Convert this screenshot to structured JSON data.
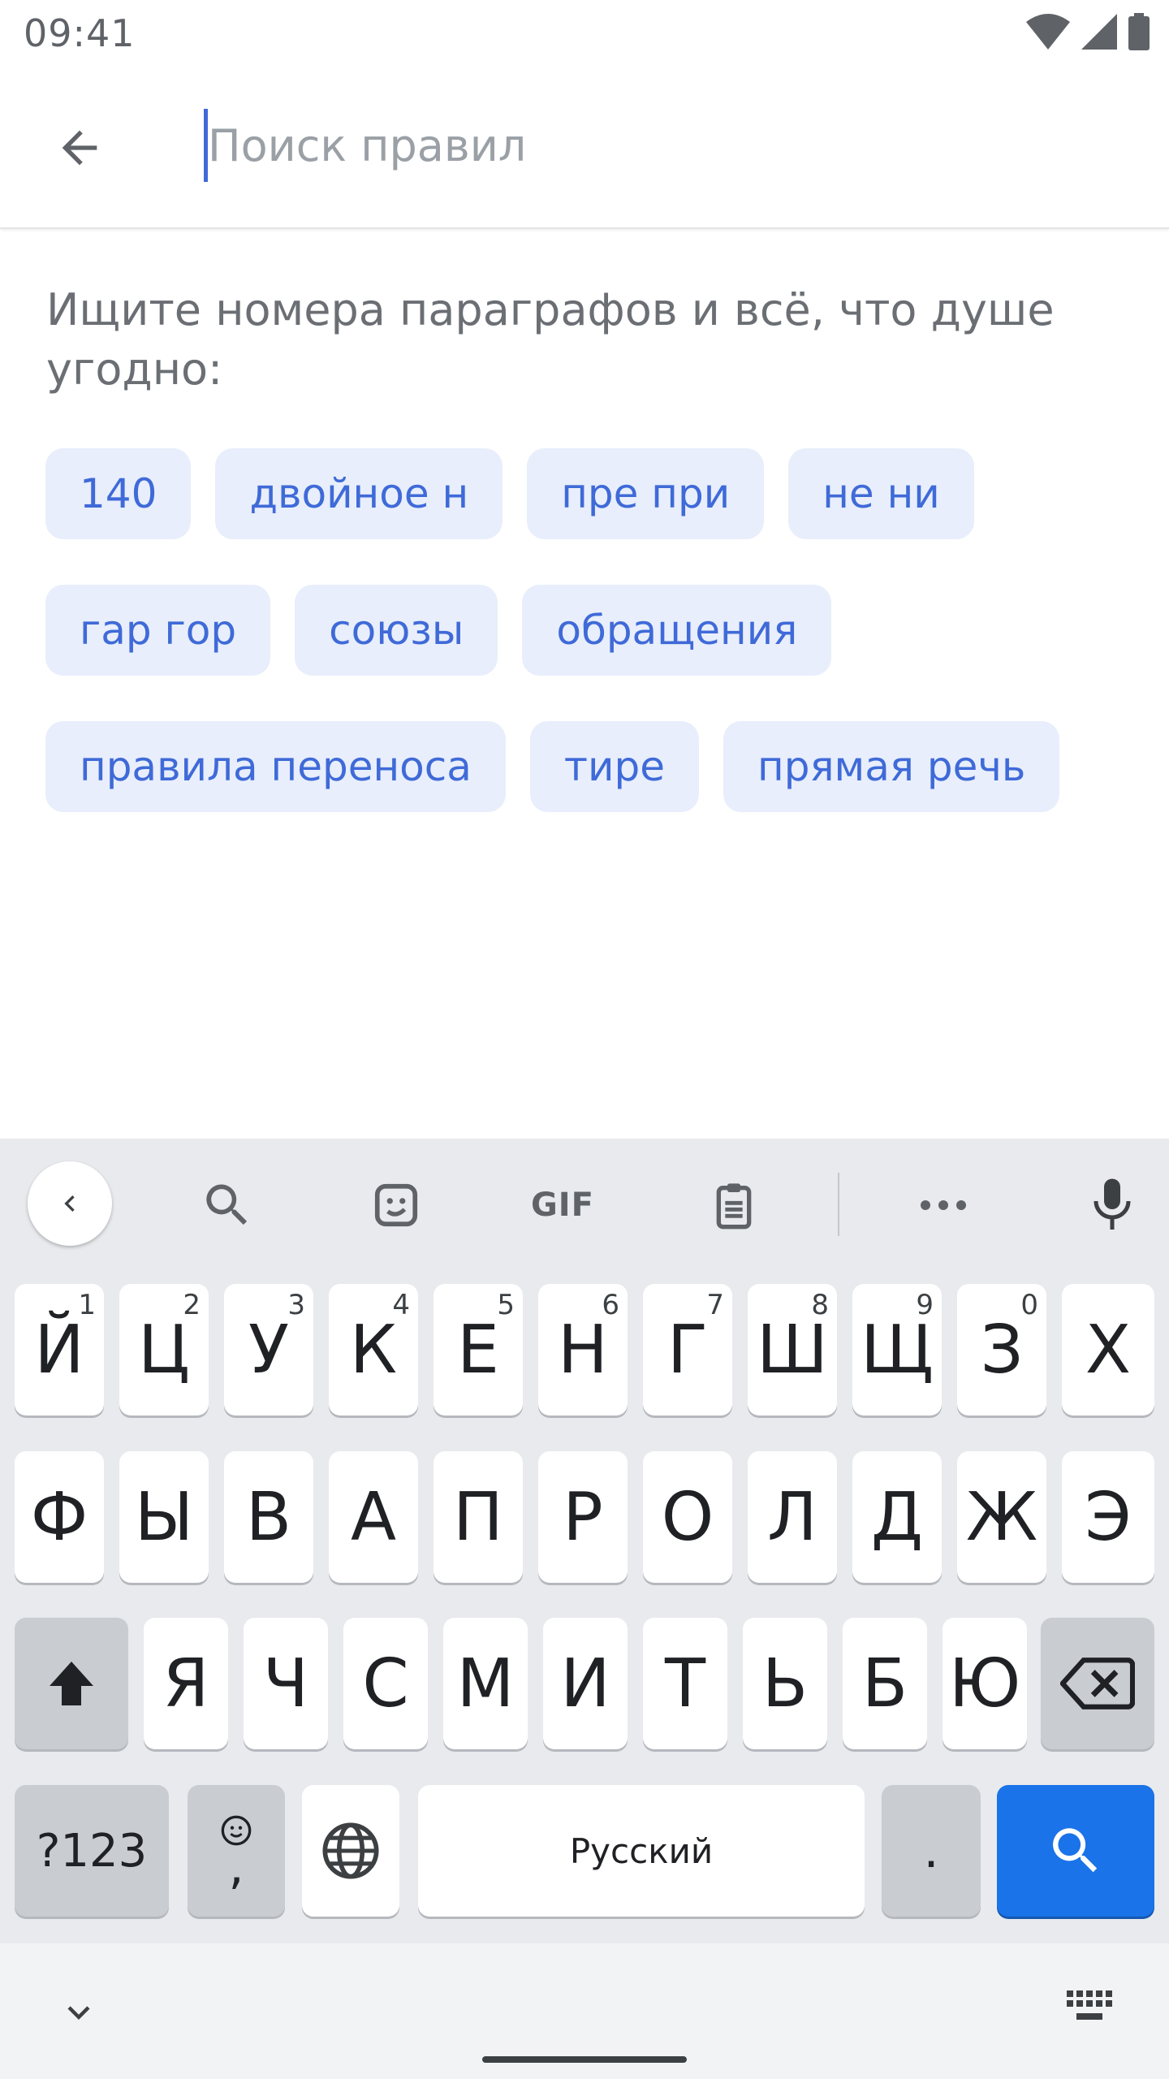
{
  "status": {
    "time": "09:41"
  },
  "search": {
    "placeholder": "Поиск правил",
    "value": ""
  },
  "hint": "Ищите номера параграфов и всё, что душе угодно:",
  "chips": [
    [
      "140",
      "двойное н",
      "пре при",
      "не ни"
    ],
    [
      "гар гор",
      "союзы",
      "обращения"
    ],
    [
      "правила переноса",
      "тире",
      "прямая речь"
    ]
  ],
  "keyboard": {
    "toolbar": [
      "back-icon",
      "search-icon",
      "sticker-icon",
      "GIF",
      "clipboard-icon",
      "more-icon",
      "mic-icon"
    ],
    "gif_label": "GIF",
    "row1": [
      "Й",
      "Ц",
      "У",
      "К",
      "Е",
      "Н",
      "Г",
      "Ш",
      "Щ",
      "З",
      "Х"
    ],
    "row1_hints": [
      "1",
      "2",
      "3",
      "4",
      "5",
      "6",
      "7",
      "8",
      "9",
      "0"
    ],
    "row2": [
      "Ф",
      "Ы",
      "В",
      "А",
      "П",
      "Р",
      "О",
      "Л",
      "Д",
      "Ж",
      "Э"
    ],
    "row3": [
      "Я",
      "Ч",
      "С",
      "М",
      "И",
      "Т",
      "Ь",
      "Б",
      "Ю"
    ],
    "symbols_label": "?123",
    "emoji_comma": ",",
    "space_label": "Русский",
    "period_label": ".",
    "accent": "#1a73e8"
  }
}
